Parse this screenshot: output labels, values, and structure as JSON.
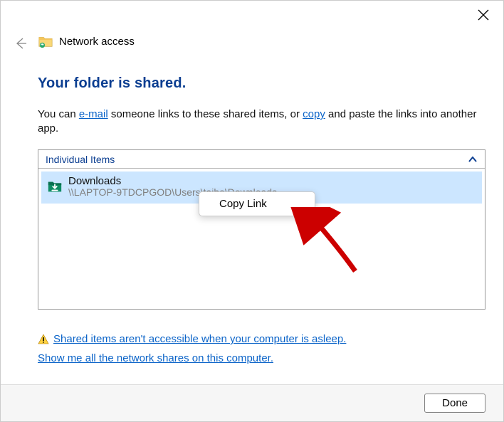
{
  "header": {
    "title": "Network access"
  },
  "heading": "Your folder is shared.",
  "intro": {
    "before": "You can ",
    "email_link": "e-mail",
    "mid": " someone links to these shared items, or ",
    "copy_link": "copy",
    "after": " and paste the links into another app."
  },
  "group": {
    "title": "Individual Items"
  },
  "item": {
    "name": "Downloads",
    "path": "\\\\LAPTOP-9TDCPGOD\\Users\\taiba\\Downloads"
  },
  "context_menu": {
    "copy_link": "Copy Link"
  },
  "warning_link": "Shared items aren't accessible when your computer is asleep.",
  "show_all_link": "Show me all the network shares on this computer.",
  "footer": {
    "done": "Done"
  }
}
